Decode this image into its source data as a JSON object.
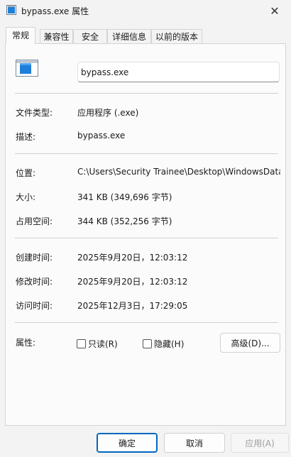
{
  "window": {
    "title": "bypass.exe 属性",
    "close_glyph": "✕"
  },
  "tabs": [
    {
      "label": "常规",
      "active": true
    },
    {
      "label": "兼容性",
      "active": false
    },
    {
      "label": "安全",
      "active": false
    },
    {
      "label": "详细信息",
      "active": false
    },
    {
      "label": "以前的版本",
      "active": false
    }
  ],
  "general": {
    "file_name": "bypass.exe",
    "file_type_label": "文件类型:",
    "file_type_value": "应用程序 (.exe)",
    "description_label": "描述:",
    "description_value": "bypass.exe",
    "location_label": "位置:",
    "location_value": "C:\\Users\\Security Trainee\\Desktop\\WindowsData",
    "size_label": "大小:",
    "size_value": "341 KB (349,696 字节)",
    "disk_size_label": "占用空间:",
    "disk_size_value": "344 KB (352,256 字节)",
    "created_label": "创建时间:",
    "created_value": "2025年9月20日，12:03:12",
    "modified_label": "修改时间:",
    "modified_value": "2025年9月20日，12:03:12",
    "accessed_label": "访问时间:",
    "accessed_value": "2025年12月3日，17:29:05",
    "attributes_label": "属性:",
    "readonly_label": "只读(R)",
    "readonly_checked": false,
    "hidden_label": "隐藏(H)",
    "hidden_checked": false,
    "advanced_button": "高级(D)..."
  },
  "footer": {
    "ok": "确定",
    "cancel": "取消",
    "apply": "应用(A)"
  },
  "colors": {
    "accent": "#0067c0",
    "icon_blue": "#1e7fd8"
  }
}
